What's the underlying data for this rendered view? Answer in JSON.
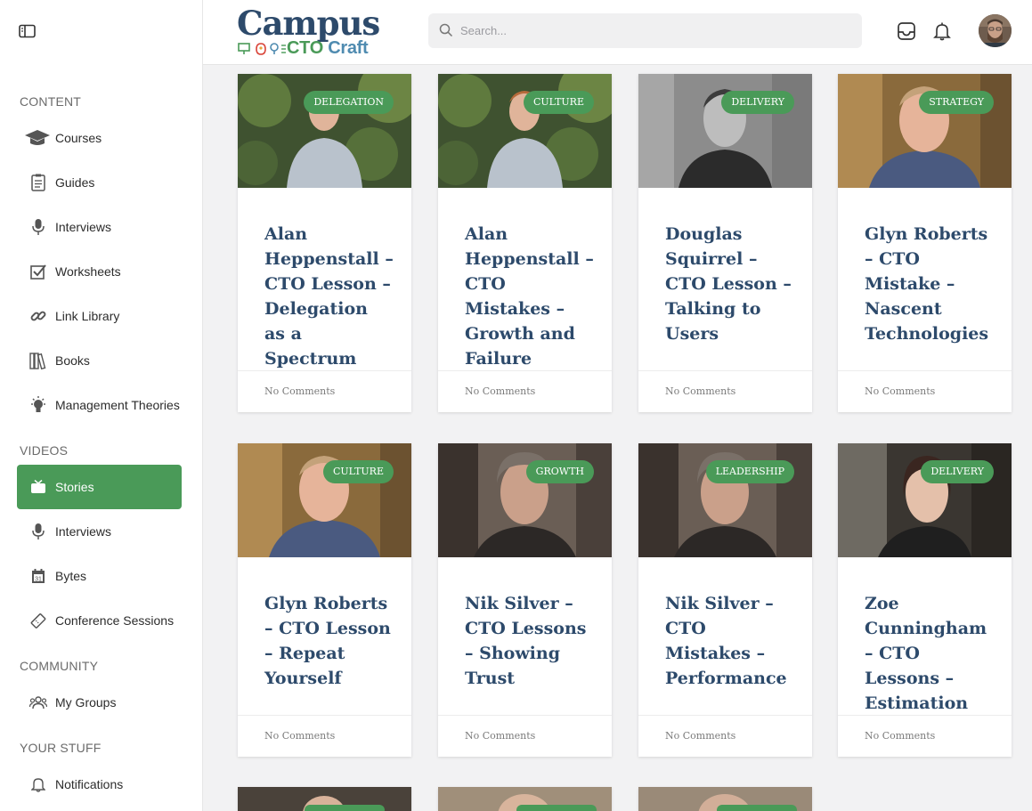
{
  "sidebar": {
    "sections": {
      "content": "CONTENT",
      "videos": "VIDEOS",
      "community": "COMMUNITY",
      "your_stuff": "YOUR STUFF"
    },
    "items": [
      {
        "label": "Courses",
        "icon": "graduation-cap-icon"
      },
      {
        "label": "Guides",
        "icon": "clipboard-icon"
      },
      {
        "label": "Interviews",
        "icon": "microphone-icon"
      },
      {
        "label": "Worksheets",
        "icon": "checkbox-icon"
      },
      {
        "label": "Link Library",
        "icon": "link-icon"
      },
      {
        "label": "Books",
        "icon": "books-icon"
      },
      {
        "label": "Management Theories",
        "icon": "lightbulb-icon"
      },
      {
        "label": "Stories",
        "icon": "tv-icon",
        "active": true
      },
      {
        "label": "Interviews",
        "icon": "microphone-icon"
      },
      {
        "label": "Bytes",
        "icon": "calendar-icon"
      },
      {
        "label": "Conference Sessions",
        "icon": "ticket-icon"
      },
      {
        "label": "My Groups",
        "icon": "users-icon"
      },
      {
        "label": "Notifications",
        "icon": "bell-icon"
      }
    ]
  },
  "header": {
    "logo_main": "Campus",
    "logo_cto": "CTO",
    "logo_craft": "Craft",
    "search_placeholder": "Search..."
  },
  "cards": [
    {
      "tag": "DELEGATION",
      "title": "Alan Heppenstall – CTO Lesson – Delegation as a Spectrum",
      "comments": "No Comments"
    },
    {
      "tag": "CULTURE",
      "title": "Alan Heppenstall – CTO Mistakes – Growth and Failure",
      "comments": "No Comments"
    },
    {
      "tag": "DELIVERY",
      "title": "Douglas Squirrel – CTO Lesson – Talking to Users",
      "comments": "No Comments"
    },
    {
      "tag": "STRATEGY",
      "title": "Glyn Roberts – CTO Mistake – Nascent Technologies",
      "comments": "No Comments"
    },
    {
      "tag": "CULTURE",
      "title": "Glyn Roberts – CTO Lesson – Repeat Yourself",
      "comments": "No Comments"
    },
    {
      "tag": "GROWTH",
      "title": "Nik Silver – CTO Lessons – Showing Trust",
      "comments": "No Comments"
    },
    {
      "tag": "LEADERSHIP",
      "title": "Nik Silver – CTO Mistakes – Performance",
      "comments": "No Comments"
    },
    {
      "tag": "DELIVERY",
      "title": "Zoe Cunningham – CTO Lessons – Estimation",
      "comments": "No Comments"
    }
  ],
  "colors": {
    "accent": "#4a9a58",
    "title": "#2d4a6b",
    "background": "#f2f2f3"
  }
}
